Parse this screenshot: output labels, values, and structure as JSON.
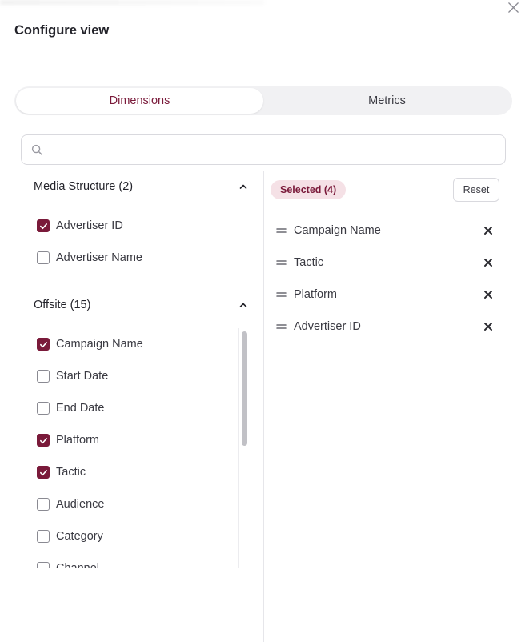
{
  "dialog": {
    "title": "Configure view"
  },
  "tabs": [
    {
      "label": "Dimensions",
      "active": true
    },
    {
      "label": "Metrics",
      "active": false
    }
  ],
  "search": {
    "value": "",
    "placeholder": ""
  },
  "groups": [
    {
      "label": "Media Structure (2)",
      "expanded": true,
      "items": [
        {
          "label": "Advertiser ID",
          "checked": true
        },
        {
          "label": "Advertiser Name",
          "checked": false
        }
      ]
    },
    {
      "label": "Offsite (15)",
      "expanded": true,
      "items": [
        {
          "label": "Campaign Name",
          "checked": true
        },
        {
          "label": "Start Date",
          "checked": false
        },
        {
          "label": "End Date",
          "checked": false
        },
        {
          "label": "Platform",
          "checked": true
        },
        {
          "label": "Tactic",
          "checked": true
        },
        {
          "label": "Audience",
          "checked": false
        },
        {
          "label": "Category",
          "checked": false
        },
        {
          "label": "Channel",
          "checked": false
        }
      ]
    }
  ],
  "selected": {
    "badge": "Selected (4)",
    "reset_label": "Reset",
    "items": [
      "Campaign Name",
      "Tactic",
      "Platform",
      "Advertiser ID"
    ]
  },
  "colors": {
    "accent": "#7a1a3a",
    "badge_bg": "#f5e1e6"
  },
  "icons": {
    "close": "close-icon",
    "search": "search-icon",
    "chevron": "chevron-up-icon",
    "drag": "drag-handle-icon",
    "remove": "remove-icon",
    "check": "checkmark-icon"
  }
}
